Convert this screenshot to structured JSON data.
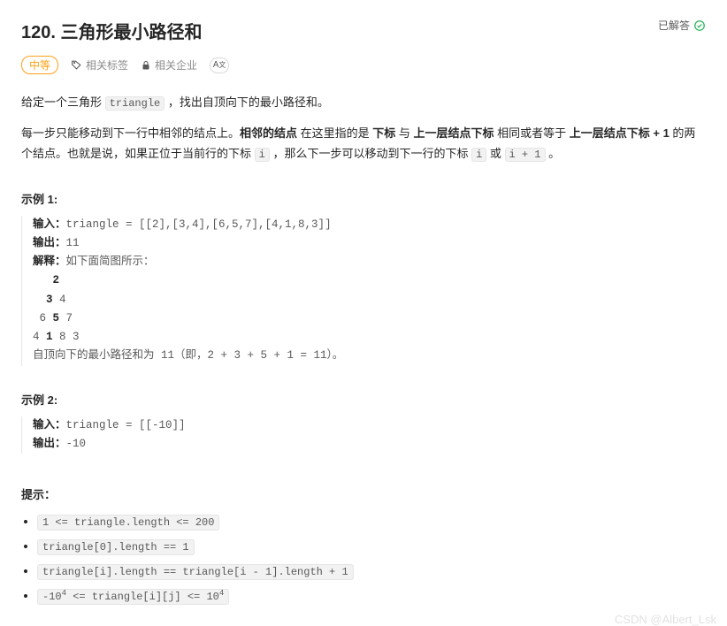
{
  "header": {
    "title": "120. 三角形最小路径和",
    "solved": "已解答"
  },
  "meta": {
    "difficulty": "中等",
    "tags_label": "相关标签",
    "companies_label": "相关企业",
    "translate": "A"
  },
  "desc": {
    "p1_a": "给定一个三角形 ",
    "p1_code": "triangle",
    "p1_b": " ，找出自顶向下的最小路径和。",
    "p2_a": "每一步只能移动到下一行中相邻的结点上。",
    "p2_b1": "相邻的结点",
    "p2_c": " 在这里指的是 ",
    "p2_b2": "下标",
    "p2_d": " 与 ",
    "p2_b3": "上一层结点下标",
    "p2_e": " 相同或者等于 ",
    "p2_b4": "上一层结点下标 + 1",
    "p2_f": " 的两个结点。也就是说，如果正位于当前行的下标 ",
    "p2_code1": "i",
    "p2_g": " ，那么下一步可以移动到下一行的下标 ",
    "p2_code2": "i",
    "p2_h": " 或 ",
    "p2_code3": "i + 1",
    "p2_i": " 。"
  },
  "ex1": {
    "title": "示例 1:",
    "in_lbl": "输入：",
    "in_val": "triangle = [[2],[3,4],[6,5,7],[4,1,8,3]]",
    "out_lbl": "输出：",
    "out_val": "11",
    "exp_lbl": "解释：",
    "exp_val": "如下面简图所示：",
    "tri_l1a": "   ",
    "tri_l1b": "2",
    "tri_l2a": "  ",
    "tri_l2b": "3",
    "tri_l2c": " 4",
    "tri_l3a": " 6 ",
    "tri_l3b": "5",
    "tri_l3c": " 7",
    "tri_l4a": "4 ",
    "tri_l4b": "1",
    "tri_l4c": " 8 3",
    "sum": "自顶向下的最小路径和为 11（即，2 + 3 + 5 + 1 = 11）。"
  },
  "ex2": {
    "title": "示例 2:",
    "in_lbl": "输入：",
    "in_val": "triangle = [[-10]]",
    "out_lbl": "输出：",
    "out_val": "-10"
  },
  "constraints": {
    "title": "提示：",
    "c1": "1 <= triangle.length <= 200",
    "c2": "triangle[0].length == 1",
    "c3": "triangle[i].length == triangle[i - 1].length + 1",
    "c4_a": "-10",
    "c4_b": " <= triangle[i][j] <= 10",
    "c4_sup": "4"
  },
  "watermark": "CSDN @Albert_Lsk"
}
